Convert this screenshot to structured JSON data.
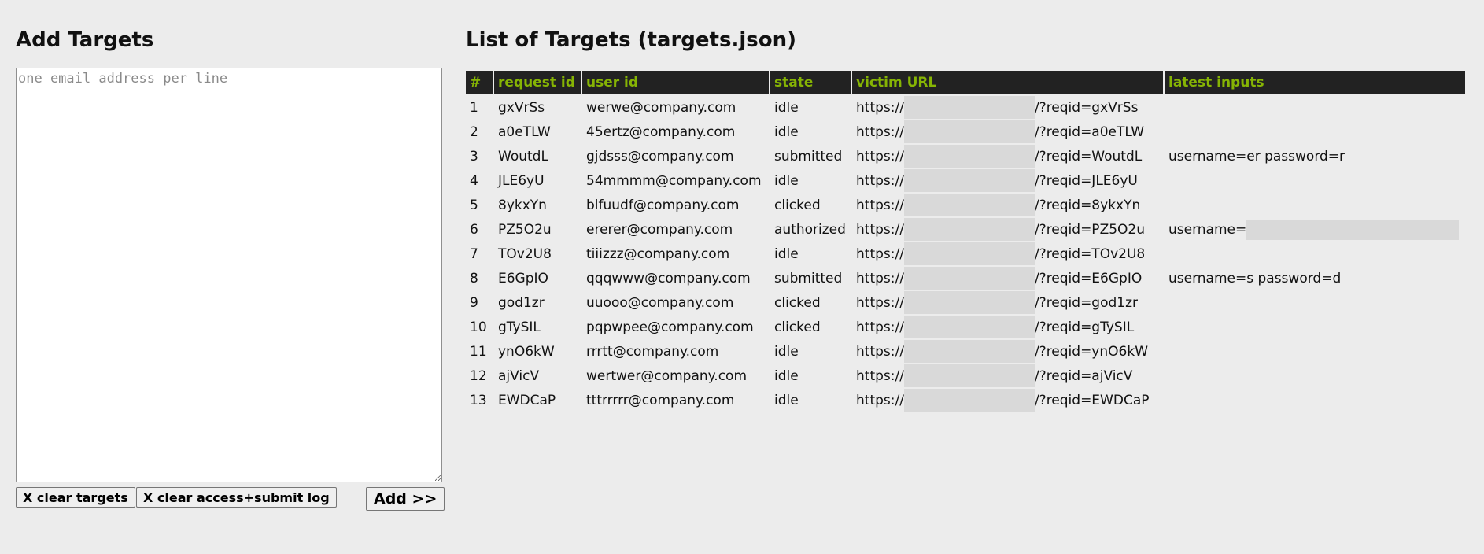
{
  "add_panel": {
    "title": "Add Targets",
    "textarea_placeholder": "one email address per line",
    "textarea_value": "",
    "clear_targets_label": "X clear targets",
    "clear_log_label": "X clear access+submit log",
    "add_label": "Add >>"
  },
  "list_panel": {
    "title": "List of Targets (targets.json)",
    "headers": [
      "#",
      "request id",
      "user id",
      "state",
      "victim URL",
      "latest inputs"
    ],
    "url_prefix": "https://",
    "rows": [
      {
        "num": "1",
        "request_id": "gxVrSs",
        "user_id": "werwe@company.com",
        "state": "idle",
        "url_suffix": "/?reqid=gxVrSs",
        "latest_inputs": ""
      },
      {
        "num": "2",
        "request_id": "a0eTLW",
        "user_id": "45ertz@company.com",
        "state": "idle",
        "url_suffix": "/?reqid=a0eTLW",
        "latest_inputs": ""
      },
      {
        "num": "3",
        "request_id": "WoutdL",
        "user_id": "gjdsss@company.com",
        "state": "submitted",
        "url_suffix": "/?reqid=WoutdL",
        "latest_inputs": "username=er password=r"
      },
      {
        "num": "4",
        "request_id": "JLE6yU",
        "user_id": "54mmmm@company.com",
        "state": "idle",
        "url_suffix": "/?reqid=JLE6yU",
        "latest_inputs": ""
      },
      {
        "num": "5",
        "request_id": "8ykxYn",
        "user_id": "blfuudf@company.com",
        "state": "clicked",
        "url_suffix": "/?reqid=8ykxYn",
        "latest_inputs": ""
      },
      {
        "num": "6",
        "request_id": "PZ5O2u",
        "user_id": "ererer@company.com",
        "state": "authorized",
        "url_suffix": "/?reqid=PZ5O2u",
        "latest_inputs": "username="
      },
      {
        "num": "7",
        "request_id": "TOv2U8",
        "user_id": "tiiizzz@company.com",
        "state": "idle",
        "url_suffix": "/?reqid=TOv2U8",
        "latest_inputs": ""
      },
      {
        "num": "8",
        "request_id": "E6GpIO",
        "user_id": "qqqwww@company.com",
        "state": "submitted",
        "url_suffix": "/?reqid=E6GpIO",
        "latest_inputs": "username=s password=d"
      },
      {
        "num": "9",
        "request_id": "god1zr",
        "user_id": "uuooo@company.com",
        "state": "clicked",
        "url_suffix": "/?reqid=god1zr",
        "latest_inputs": ""
      },
      {
        "num": "10",
        "request_id": "gTySIL",
        "user_id": "pqpwpee@company.com",
        "state": "clicked",
        "url_suffix": "/?reqid=gTySIL",
        "latest_inputs": ""
      },
      {
        "num": "11",
        "request_id": "ynO6kW",
        "user_id": "rrrtt@company.com",
        "state": "idle",
        "url_suffix": "/?reqid=ynO6kW",
        "latest_inputs": ""
      },
      {
        "num": "12",
        "request_id": "ajVicV",
        "user_id": "wertwer@company.com",
        "state": "idle",
        "url_suffix": "/?reqid=ajVicV",
        "latest_inputs": ""
      },
      {
        "num": "13",
        "request_id": "EWDCaP",
        "user_id": "tttrrrrr@company.com",
        "state": "idle",
        "url_suffix": "/?reqid=EWDCaP",
        "latest_inputs": ""
      }
    ]
  },
  "colors": {
    "background": "#ececec",
    "header_bg": "#222222",
    "header_text": "#86b404",
    "redaction": "#d9d9d9"
  }
}
